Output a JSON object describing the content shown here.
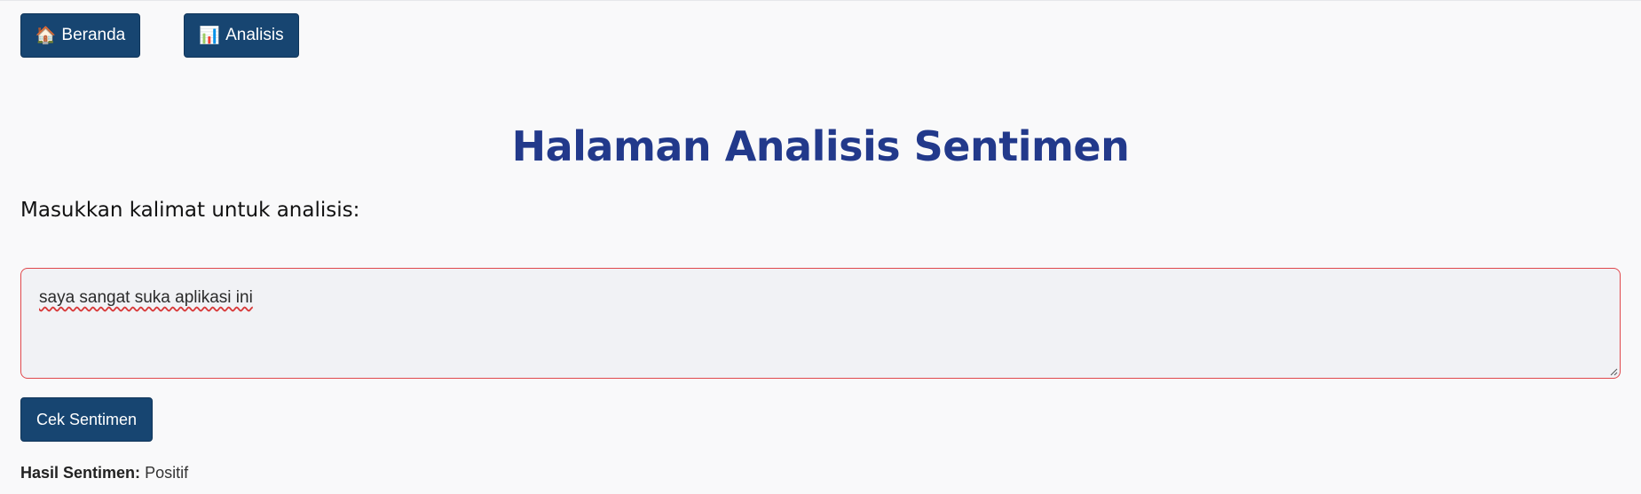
{
  "nav": {
    "home": {
      "icon": "house-icon",
      "glyph": "🏠",
      "label": "Beranda"
    },
    "analysis": {
      "icon": "bar-chart-icon",
      "glyph": "📊",
      "label": "Analisis"
    }
  },
  "main": {
    "title": "Halaman Analisis Sentimen",
    "prompt_label": "Masukkan kalimat untuk analisis:",
    "input_value": "saya sangat suka aplikasi ini",
    "check_button": "Cek Sentimen",
    "result_label": "Hasil Sentimen:",
    "result_value": "Positif"
  },
  "colors": {
    "button_bg": "#174571",
    "title": "#22398b",
    "input_border": "#e0484c",
    "page_bg": "#f9f9fa"
  }
}
